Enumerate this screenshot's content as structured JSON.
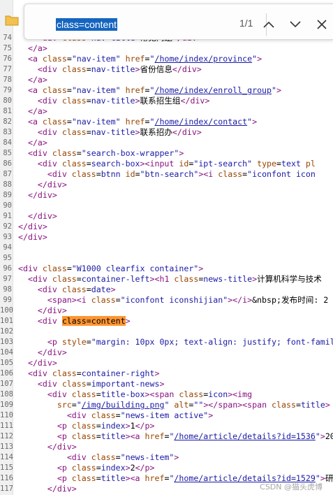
{
  "find": {
    "query": "class=content",
    "count": "1/1"
  },
  "watermark": "CSDN @猫头虎博",
  "lines": [
    {
      "n": "74",
      "html": "    <span class='t'>&lt;div</span> <span class='a'>class</span>=<span class='v'>nav-title</span><span class='t'>&gt;</span>常见问题<span class='t'>&lt;/div&gt;</span>"
    },
    {
      "n": "75",
      "html": "  <span class='t'>&lt;/a&gt;</span>"
    },
    {
      "n": "76",
      "html": "  <span class='t'>&lt;a</span> <span class='a'>class</span>=<span class='v'>\"nav-item\"</span> <span class='a'>href</span>=<span class='v'>\"</span><span class='u'>/home/index/province</span><span class='v'>\"</span><span class='t'>&gt;</span>"
    },
    {
      "n": "77",
      "html": "    <span class='t'>&lt;div</span> <span class='a'>class</span>=<span class='v'>nav-title</span><span class='t'>&gt;</span>省份信息<span class='t'>&lt;/div&gt;</span>"
    },
    {
      "n": "78",
      "html": "  <span class='t'>&lt;/a&gt;</span>"
    },
    {
      "n": "79",
      "html": "  <span class='t'>&lt;a</span> <span class='a'>class</span>=<span class='v'>\"nav-item\"</span> <span class='a'>href</span>=<span class='v'>\"</span><span class='u'>/home/index/enroll_group</span><span class='v'>\"</span><span class='t'>&gt;</span>"
    },
    {
      "n": "80",
      "html": "    <span class='t'>&lt;div</span> <span class='a'>class</span>=<span class='v'>nav-title</span><span class='t'>&gt;</span>联系招生组<span class='t'>&lt;/div&gt;</span>"
    },
    {
      "n": "81",
      "html": "  <span class='t'>&lt;/a&gt;</span>"
    },
    {
      "n": "82",
      "html": "  <span class='t'>&lt;a</span> <span class='a'>class</span>=<span class='v'>\"nav-item\"</span> <span class='a'>href</span>=<span class='v'>\"</span><span class='u'>/home/index/contact</span><span class='v'>\"</span><span class='t'>&gt;</span>"
    },
    {
      "n": "83",
      "html": "    <span class='t'>&lt;div</span> <span class='a'>class</span>=<span class='v'>nav-title</span><span class='t'>&gt;</span>联系招办<span class='t'>&lt;/div&gt;</span>"
    },
    {
      "n": "84",
      "html": "  <span class='t'>&lt;/a&gt;</span>"
    },
    {
      "n": "85",
      "html": "  <span class='t'>&lt;div</span> <span class='a'>class</span>=<span class='v'>\"search-box-wrapper\"</span><span class='t'>&gt;</span>"
    },
    {
      "n": "86",
      "html": "    <span class='t'>&lt;div</span> <span class='a'>class</span>=<span class='v'>search-box</span><span class='t'>&gt;&lt;input</span> <span class='a'>id</span>=<span class='v'>\"ipt-search\"</span> <span class='a'>type</span>=<span class='v'>text</span> <span class='a'>pl</span>"
    },
    {
      "n": "87",
      "html": "      <span class='t'>&lt;div</span> <span class='a'>class</span>=<span class='v'>btnn</span> <span class='a'>id</span>=<span class='v'>\"btn-search\"</span><span class='t'>&gt;&lt;i</span> <span class='a'>class</span>=<span class='v'>\"iconfont icon</span>"
    },
    {
      "n": "88",
      "html": "    <span class='t'>&lt;/div&gt;</span>"
    },
    {
      "n": "89",
      "html": "  <span class='t'>&lt;/div&gt;</span>"
    },
    {
      "n": "90",
      "html": ""
    },
    {
      "n": "91",
      "html": "  <span class='t'>&lt;/div&gt;</span>"
    },
    {
      "n": "92",
      "html": "<span class='t'>&lt;/div&gt;</span>"
    },
    {
      "n": "93",
      "html": "<span class='t'>&lt;/div&gt;</span>"
    },
    {
      "n": "94",
      "html": ""
    },
    {
      "n": "95",
      "html": ""
    },
    {
      "n": "96",
      "html": "<span class='t'>&lt;div</span> <span class='a'>class</span>=<span class='v'>\"W1000 clearfix container\"</span><span class='t'>&gt;</span>"
    },
    {
      "n": "97",
      "html": "  <span class='t'>&lt;div</span> <span class='a'>class</span>=<span class='v'>container-left</span><span class='t'>&gt;&lt;h1</span> <span class='a'>class</span>=<span class='v'>news-title</span><span class='t'>&gt;</span>计算机科学与技术"
    },
    {
      "n": "98",
      "html": "    <span class='t'>&lt;div</span> <span class='a'>class</span>=<span class='v'>date</span><span class='t'>&gt;</span>"
    },
    {
      "n": "99",
      "html": "      <span class='t'>&lt;span&gt;&lt;i</span> <span class='a'>class</span>=<span class='v'>\"iconfont iconshijian\"</span><span class='t'>&gt;&lt;/i&gt;</span>&amp;nbsp;发布时间: 2"
    },
    {
      "n": "100",
      "html": "    <span class='t'>&lt;/div&gt;</span>"
    },
    {
      "n": "101",
      "html": "    <span class='t'>&lt;div</span> <span class='hl'>class=content</span><span class='t'>&gt;</span>"
    },
    {
      "n": "102",
      "html": ""
    },
    {
      "n": "103",
      "html": "      <span class='t'>&lt;p</span> <span class='a'>style</span>=<span class='v'>\"margin: 10px 0px; text-align: justify; font-famil</span>"
    },
    {
      "n": "104",
      "html": "    <span class='t'>&lt;/div&gt;</span>"
    },
    {
      "n": "105",
      "html": "  <span class='t'>&lt;/div&gt;</span>"
    },
    {
      "n": "106",
      "html": "  <span class='t'>&lt;div</span> <span class='a'>class</span>=<span class='v'>container-right</span><span class='t'>&gt;</span>"
    },
    {
      "n": "107",
      "html": "    <span class='t'>&lt;div</span> <span class='a'>class</span>=<span class='v'>important-news</span><span class='t'>&gt;</span>"
    },
    {
      "n": "108",
      "html": "      <span class='t'>&lt;div</span> <span class='a'>class</span>=<span class='v'>title-box</span><span class='t'>&gt;&lt;span</span> <span class='a'>class</span>=<span class='v'>icon</span><span class='t'>&gt;&lt;img</span>"
    },
    {
      "n": "109",
      "html": "        <span class='a'>src</span>=<span class='v'>\"</span><span class='u'>/img/building.png</span><span class='v'>\"</span> <span class='a'>alt</span>=<span class='v'>\"\"</span><span class='t'>&gt;&lt;/span&gt;&lt;span</span> <span class='a'>class</span>=<span class='v'>title</span><span class='t'>&gt;</span>"
    },
    {
      "n": "110",
      "html": "          <span class='t'>&lt;div</span> <span class='a'>class</span>=<span class='v'>\"news-item active\"</span><span class='t'>&gt;</span>"
    },
    {
      "n": "111",
      "html": "        <span class='t'>&lt;p</span> <span class='a'>class</span>=<span class='v'>index</span><span class='t'>&gt;</span>1<span class='t'>&lt;/p&gt;</span>"
    },
    {
      "n": "112",
      "html": "        <span class='t'>&lt;p</span> <span class='a'>class</span>=<span class='v'>title</span><span class='t'>&gt;&lt;a</span> <span class='a'>href</span>=<span class='v'>\"</span><span class='u'>/home/article/details?id=1536</span><span class='v'>\"</span><span class='t'>&gt;</span>20"
    },
    {
      "n": "113",
      "html": "      <span class='t'>&lt;/div&gt;</span>"
    },
    {
      "n": "114",
      "html": "          <span class='t'>&lt;div</span> <span class='a'>class</span>=<span class='v'>\"news-item\"</span><span class='t'>&gt;</span>"
    },
    {
      "n": "115",
      "html": "        <span class='t'>&lt;p</span> <span class='a'>class</span>=<span class='v'>index</span><span class='t'>&gt;</span>2<span class='t'>&lt;/p&gt;</span>"
    },
    {
      "n": "116",
      "html": "        <span class='t'>&lt;p</span> <span class='a'>class</span>=<span class='v'>title</span><span class='t'>&gt;&lt;a</span> <span class='a'>href</span>=<span class='v'>\"</span><span class='u'>/home/article/details?id=1529</span><span class='v'>\"</span><span class='t'>&gt;</span>研"
    },
    {
      "n": "117",
      "html": "      <span class='t'>&lt;/div&gt;</span>"
    }
  ]
}
